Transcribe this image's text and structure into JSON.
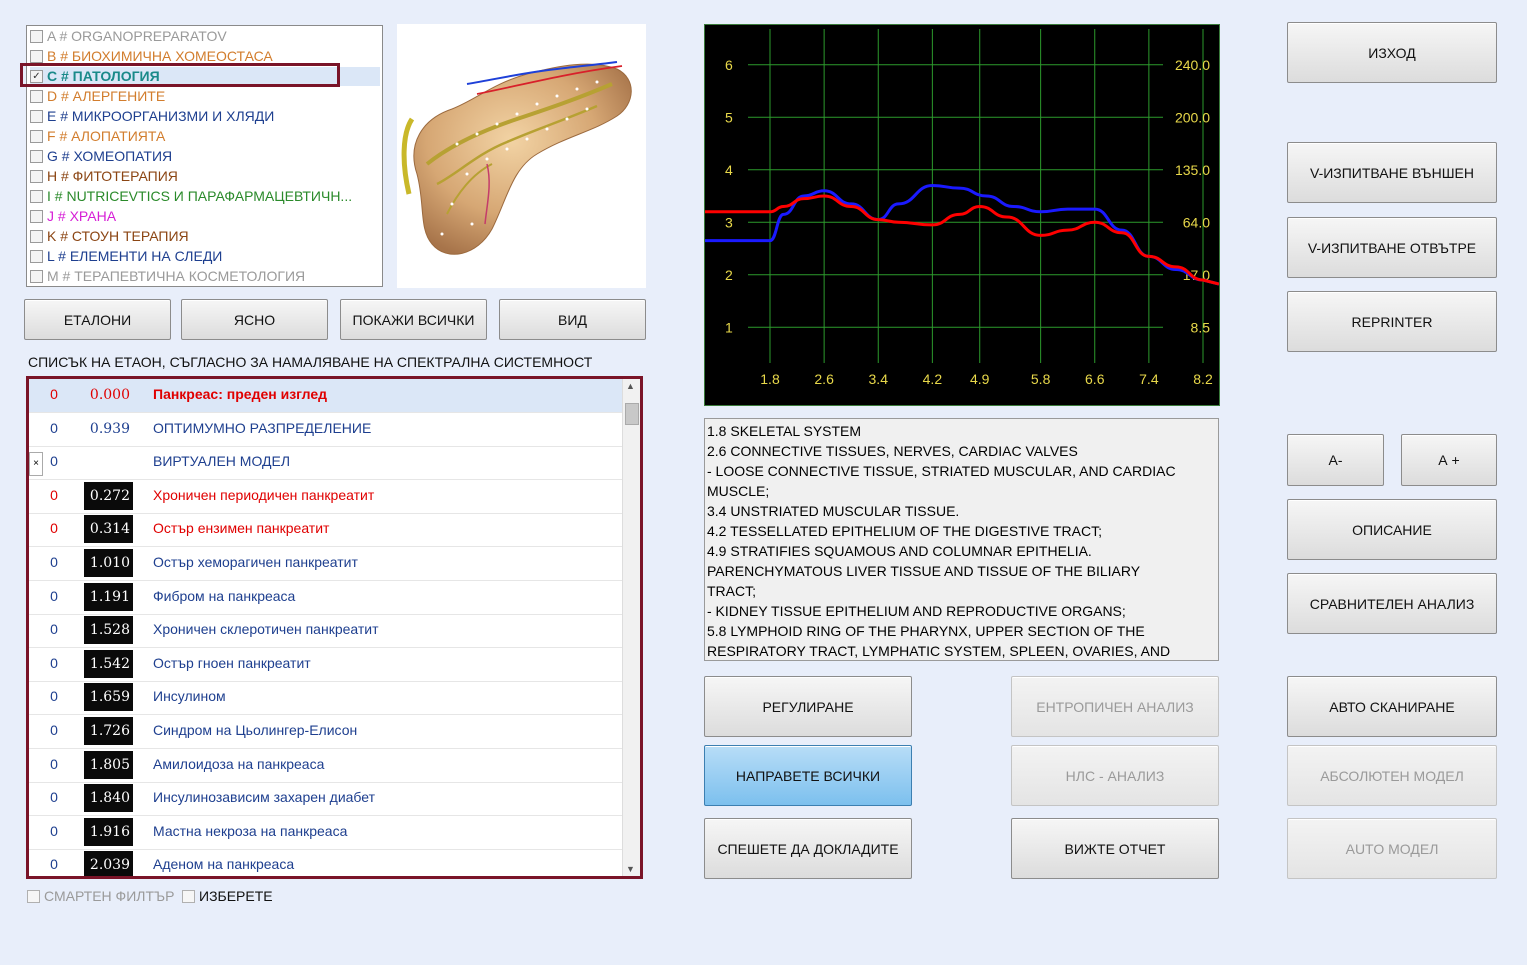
{
  "categories": [
    {
      "label": "A # ORGANOPREPARATOV",
      "color": "#9a9a9a",
      "checked": false
    },
    {
      "label": "B # БИОХИМИЧНА ХОМЕОСТАСА",
      "color": "#d27d2d",
      "checked": false
    },
    {
      "label": "C # ПАТОЛОГИЯ",
      "color": "#1a8a8a",
      "checked": true
    },
    {
      "label": "D # АЛЕРГЕНИТЕ",
      "color": "#d27d2d",
      "checked": false
    },
    {
      "label": "E # МИКРООРГАНИЗМИ И ХЛЯДИ",
      "color": "#1e3f8f",
      "checked": false
    },
    {
      "label": "F # АЛОПАТИЯТА",
      "color": "#d27d2d",
      "checked": false
    },
    {
      "label": "G # ХОМЕОПАТИЯ",
      "color": "#1e3f8f",
      "checked": false
    },
    {
      "label": "H # ФИТОТЕРАПИЯ",
      "color": "#8b4513",
      "checked": false
    },
    {
      "label": "I # NUTRICEVTICS И ПАРАФАРМАЦЕВТИЧН...",
      "color": "#2a8a2a",
      "checked": false
    },
    {
      "label": "J # ХРАНА",
      "color": "#d61ed6",
      "checked": false
    },
    {
      "label": "K # СТОУН ТЕРАПИЯ",
      "color": "#8b4513",
      "checked": false
    },
    {
      "label": "L # ЕЛЕМЕНТИ НА СЛЕДИ",
      "color": "#1e3f8f",
      "checked": false
    },
    {
      "label": "M # ТЕРАПЕВТИЧНА КОСМЕТОЛОГИЯ",
      "color": "#9a9a9a",
      "checked": false
    }
  ],
  "toolbar": {
    "etaloni": "ЕТАЛОНИ",
    "clear": "ЯСНО",
    "show_all": "ПОКАЖИ ВСИЧКИ",
    "view": "ВИД"
  },
  "list_caption": "СПИСЪК НА ЕТАОН, СЪГЛАСНО ЗА НАМАЛЯВАНЕ НА СПЕКТРАЛНА СИСТЕМНОСТ",
  "etalons": [
    {
      "col": "0",
      "value": "0.000",
      "name": "Панкреас: преден изглед",
      "color": "#e00000",
      "bold": true,
      "dark": false
    },
    {
      "col": "0",
      "value": "0.939",
      "name": "ОПТИМУМНО РАЗПРЕДЕЛЕНИЕ",
      "color": "#1e3f8f",
      "bold": false,
      "dark": false
    },
    {
      "col": "0",
      "value": "",
      "name": "ВИРТУАЛЕН МОДЕЛ",
      "color": "#1e3f8f",
      "bold": false,
      "dark": false
    },
    {
      "col": "0",
      "value": "0.272",
      "name": "Хроничен периодичен панкреатит",
      "color": "#e00000",
      "bold": false,
      "dark": true
    },
    {
      "col": "0",
      "value": "0.314",
      "name": "Остър ензимен панкреатит",
      "color": "#e00000",
      "bold": false,
      "dark": true
    },
    {
      "col": "0",
      "value": "1.010",
      "name": "Остър хеморагичен панкреатит",
      "color": "#1e3f8f",
      "bold": false,
      "dark": true
    },
    {
      "col": "0",
      "value": "1.191",
      "name": "Фибром на панкреаса",
      "color": "#1e3f8f",
      "bold": false,
      "dark": true
    },
    {
      "col": "0",
      "value": "1.528",
      "name": "Хроничен склеротичен панкреатит",
      "color": "#1e3f8f",
      "bold": false,
      "dark": true
    },
    {
      "col": "0",
      "value": "1.542",
      "name": "Остър гноен панкреатит",
      "color": "#1e3f8f",
      "bold": false,
      "dark": true
    },
    {
      "col": "0",
      "value": "1.659",
      "name": "Инсулином",
      "color": "#1e3f8f",
      "bold": false,
      "dark": true
    },
    {
      "col": "0",
      "value": "1.726",
      "name": "Синдром на Цьолингер-Елисон",
      "color": "#1e3f8f",
      "bold": false,
      "dark": true
    },
    {
      "col": "0",
      "value": "1.805",
      "name": "Амилоидоза на панкреаса",
      "color": "#1e3f8f",
      "bold": false,
      "dark": true
    },
    {
      "col": "0",
      "value": "1.840",
      "name": "Инсулинозависим захарен диабет",
      "color": "#1e3f8f",
      "bold": false,
      "dark": true
    },
    {
      "col": "0",
      "value": "1.916",
      "name": "Мастна некроза на панкреаса",
      "color": "#1e3f8f",
      "bold": false,
      "dark": true
    },
    {
      "col": "0",
      "value": "2.039",
      "name": "Аденом на панкреаса",
      "color": "#1e3f8f",
      "bold": false,
      "dark": true
    }
  ],
  "bottom_checks": {
    "smart_filter": "СМАРТЕН ФИЛТЪР",
    "select": "ИЗБЕРЕТЕ"
  },
  "chart_data": {
    "type": "line",
    "title": "",
    "x_ticks": [
      "1.8",
      "2.6",
      "3.4",
      "4.2",
      "4.9",
      "5.8",
      "6.6",
      "7.4",
      "8.2"
    ],
    "y_left_ticks": [
      "6",
      "5",
      "4",
      "3",
      "2",
      "1"
    ],
    "y_right_ticks": [
      "240.0",
      "200.0",
      "135.0",
      "64.0",
      "17.0",
      "8.5"
    ],
    "ylim": [
      0.7,
      6.3
    ],
    "grid": true,
    "series": [
      {
        "color": "#1a1aff",
        "x": [
          1.8,
          2.0,
          2.3,
          2.6,
          3.0,
          3.4,
          3.7,
          4.2,
          4.6,
          5.0,
          5.4,
          5.8,
          6.2,
          6.6,
          7.0,
          7.4,
          7.8,
          8.2
        ],
        "y": [
          2.65,
          3.15,
          3.5,
          3.6,
          3.35,
          3.05,
          3.35,
          3.7,
          3.65,
          3.5,
          3.3,
          3.2,
          3.25,
          3.25,
          2.85,
          2.35,
          2.1,
          1.9
        ]
      },
      {
        "color": "#ff0000",
        "x": [
          1.8,
          2.0,
          2.3,
          2.6,
          3.0,
          3.4,
          3.7,
          4.2,
          4.6,
          4.9,
          5.3,
          5.8,
          6.2,
          6.6,
          7.0,
          7.4,
          7.8,
          8.2
        ],
        "y": [
          3.2,
          3.3,
          3.45,
          3.5,
          3.3,
          3.05,
          3.0,
          2.95,
          3.15,
          3.3,
          3.1,
          2.75,
          2.85,
          3.0,
          2.8,
          2.35,
          2.15,
          1.9
        ]
      }
    ]
  },
  "info_lines": [
    "1.8 SKELETAL SYSTEM",
    "2.6 CONNECTIVE TISSUES, NERVES, CARDIAC VALVES",
    "- LOOSE CONNECTIVE TISSUE, STRIATED MUSCULAR, AND CARDIAC",
    "MUSCLE;",
    "3.4 UNSTRIATED MUSCULAR TISSUE.",
    "4.2 TESSELLATED EPITHELIUM OF THE DIGESTIVE TRACT;",
    "4.9 STRATIFIES SQUAMOUS AND COLUMNAR EPITHELIA.",
    "PARENCHYMATOUS LIVER TISSUE AND TISSUE OF THE BILIARY",
    "TRACT;",
    "- KIDNEY TISSUE EPITHELIUM AND REPRODUCTIVE ORGANS;",
    "5.8 LYMPHOID RING OF THE PHARYNX, UPPER SECTION OF THE",
    "RESPIRATORY TRACT, LYMPHATIC SYSTEM, SPLEEN, OVARIES, AND"
  ],
  "buttons": {
    "regulation": "РЕГУЛИРАНЕ",
    "do_all": "НАПРАВЕТЕ ВСИЧКИ",
    "hurry_report": "СПЕШЕТЕ ДА ДОКЛАДИТЕ",
    "entropy": "ЕНТРОПИЧЕН АНАЛИЗ",
    "nls": "НЛС - АНАЛИЗ",
    "view_report": "ВИЖТЕ ОТЧЕТ",
    "exit": "ИЗХОД",
    "v_outer": "V-ИЗПИТВАНЕ ВЪНШЕН",
    "v_inner": "V-ИЗПИТВАНЕ ОТВЪТРЕ",
    "reprinter": "REPRINTER",
    "a_minus": "А-",
    "a_plus": "А +",
    "description": "ОПИСАНИЕ",
    "compare": "СРАВНИТЕЛЕН АНАЛИЗ",
    "auto_scan": "АВТО СКАНИРАНЕ",
    "absolute_model": "АБСОЛЮТЕН МОДЕЛ",
    "auto_model": "AUTO МОДЕЛ"
  }
}
